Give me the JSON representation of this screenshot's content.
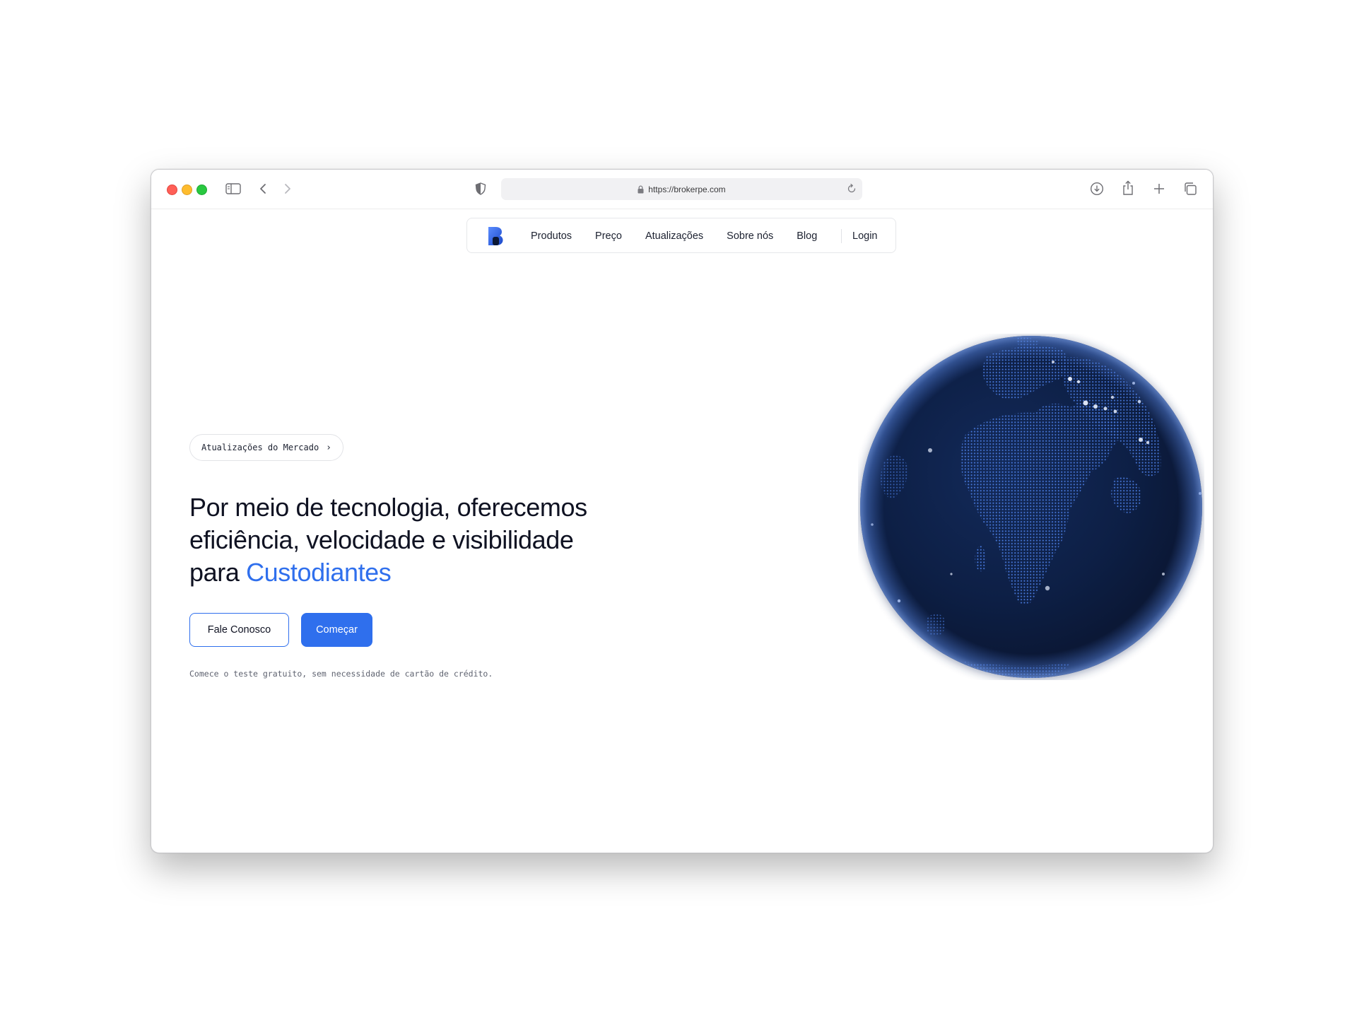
{
  "browser": {
    "url": "https://brokerpe.com",
    "icons": [
      "sidebar-toggle-icon",
      "back-chevron-icon",
      "forward-chevron-icon",
      "privacy-shield-icon",
      "lock-icon",
      "reload-icon",
      "download-icon",
      "share-icon",
      "new-tab-plus-icon",
      "tab-overview-icon"
    ]
  },
  "nav": {
    "logo_icon": "brand-b-logo-icon",
    "links": [
      "Produtos",
      "Preço",
      "Atualizações",
      "Sobre nós",
      "Blog"
    ],
    "login": "Login"
  },
  "hero": {
    "pill_label": "Atualizações do Mercado",
    "pill_chevron": "›",
    "headline_main": "Por meio de tecnologia, oferecemos eficiência, velocidade e visibilidade para ",
    "headline_accent": "Custodiantes",
    "btn_contact": "Fale Conosco",
    "btn_start": "Começar",
    "note": "Comece o teste gratuito, sem necessidade de cartão de crédito."
  },
  "colors": {
    "accent": "#2f6fed",
    "text": "#0f1222",
    "globe_ocean": "#0b1836",
    "globe_dots": "#4c7fe6"
  },
  "illustration": {
    "icon": "dotted-earth-globe-icon"
  }
}
